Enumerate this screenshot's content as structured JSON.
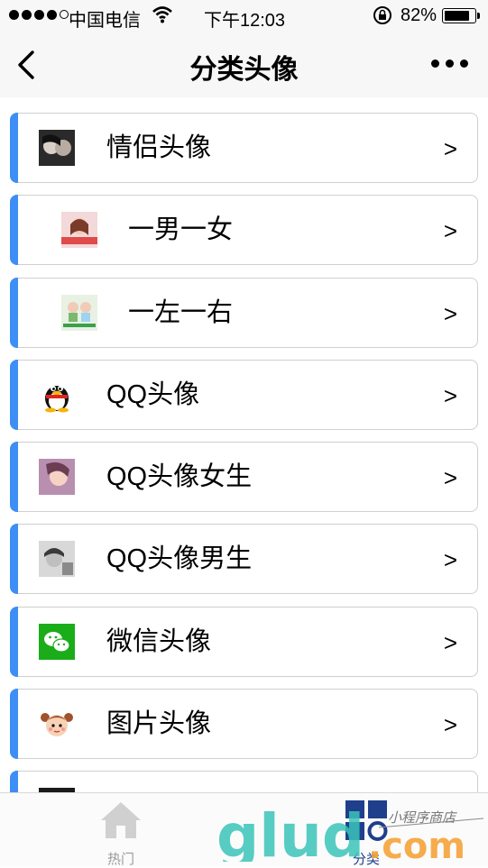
{
  "status_bar": {
    "carrier": "中国电信",
    "time": "下午12:03",
    "battery_pct": "82%",
    "battery_level": 0.82
  },
  "navbar": {
    "title": "分类头像",
    "back_icon": "chevron-left-icon",
    "more_icon": "ellipsis-icon"
  },
  "categories": [
    {
      "label": "情侣头像",
      "arrow": ">",
      "thumb": "couple-photo"
    },
    {
      "label": "一男一女",
      "arrow": ">",
      "thumb": "girl-photo"
    },
    {
      "label": "一左一右",
      "arrow": ">",
      "thumb": "pair-photo"
    },
    {
      "label": "QQ头像",
      "arrow": ">",
      "thumb": "qq-penguin-icon"
    },
    {
      "label": "QQ头像女生",
      "arrow": ">",
      "thumb": "girl-photo"
    },
    {
      "label": "QQ头像男生",
      "arrow": ">",
      "thumb": "boy-photo"
    },
    {
      "label": "微信头像",
      "arrow": ">",
      "thumb": "wechat-icon"
    },
    {
      "label": "图片头像",
      "arrow": ">",
      "thumb": "cartoon-girl-icon"
    }
  ],
  "tabbar": {
    "tabs": [
      {
        "label": "热门",
        "icon": "home-icon"
      },
      {
        "label": "分类",
        "icon": "category-icon"
      }
    ]
  },
  "watermark": {
    "text": "glud",
    "suffix": ".com",
    "tagline": "小程序商店"
  },
  "colors": {
    "accent": "#3d8ff5",
    "tab_active": "#1f3f8c",
    "watermark_teal": "#39c3b8",
    "watermark_orange": "#f5a33a"
  }
}
